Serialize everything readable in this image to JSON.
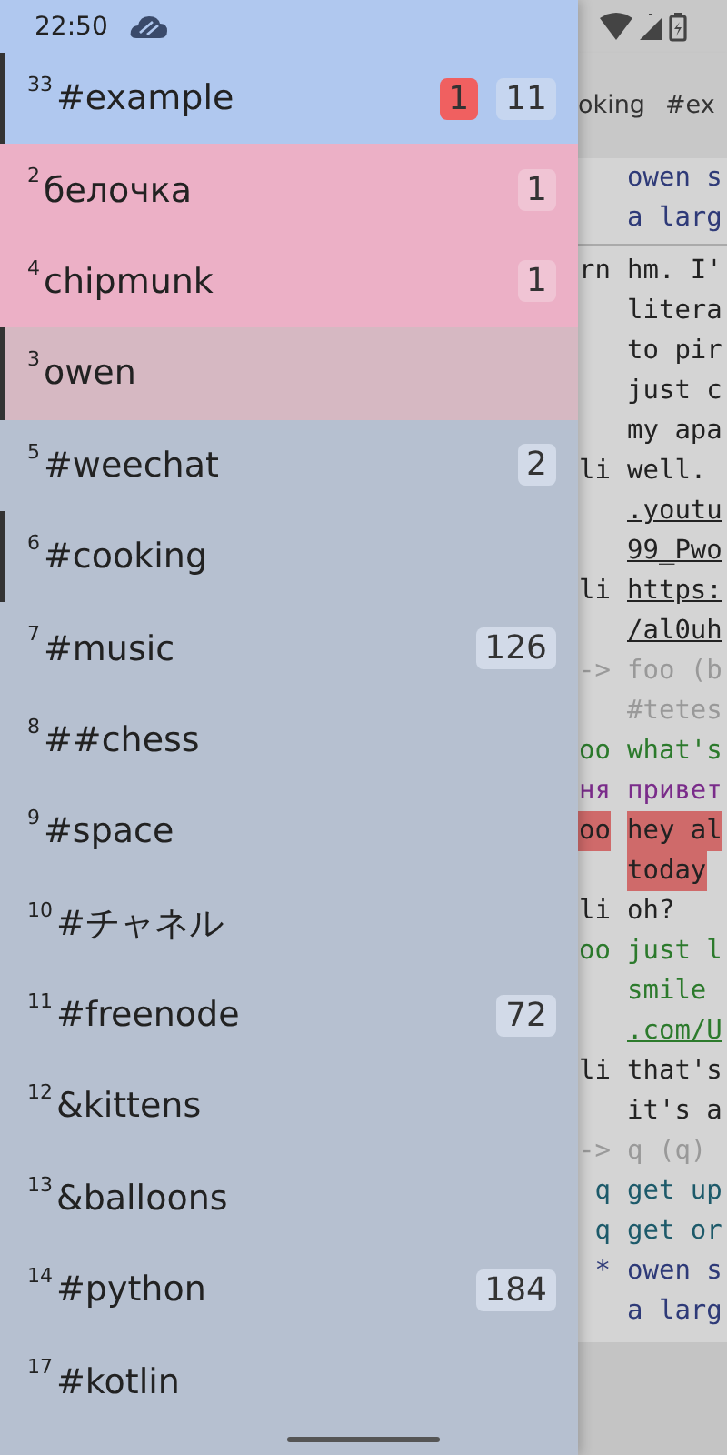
{
  "status_bar": {
    "time": "22:50"
  },
  "chat": {
    "tabs": [
      "oking",
      "#ex"
    ],
    "messages": [
      {
        "kind": "action",
        "lines": [
          {
            "text": "owen s",
            "link": false
          },
          {
            "text": "a larg",
            "link": false
          }
        ],
        "highlight": false
      },
      {
        "prefix": "rn",
        "kind": "normal",
        "lines": [
          {
            "text": "hm. I'",
            "link": false
          },
          {
            "text": "litera",
            "link": false
          },
          {
            "text": "to pir",
            "link": false
          },
          {
            "text": "just c",
            "link": false
          },
          {
            "text": "my apa",
            "link": false
          }
        ],
        "highlight": false
      },
      {
        "prefix": "li",
        "kind": "normal",
        "lines": [
          {
            "text": "well.",
            "link": false
          },
          {
            "text": ".youtu",
            "link": true
          },
          {
            "text": "99_Pwo",
            "link": true
          }
        ],
        "highlight": false
      },
      {
        "prefix": "li",
        "kind": "normal",
        "lines": [
          {
            "text": "https:",
            "link": true
          },
          {
            "text": "/al0uh",
            "link": true
          }
        ],
        "highlight": false
      },
      {
        "prefix": "->",
        "kind": "join",
        "lines": [
          {
            "text": "foo (b",
            "link": false
          },
          {
            "text": "#tetes",
            "link": false
          }
        ],
        "highlight": false
      },
      {
        "prefix": "oo",
        "kind": "green",
        "lines": [
          {
            "text": "what's",
            "link": false
          }
        ],
        "highlight": false
      },
      {
        "prefix": "ня",
        "kind": "purple",
        "lines": [
          {
            "text": "привет",
            "link": false
          }
        ],
        "highlight": false
      },
      {
        "prefix": "oo",
        "kind": "normal",
        "lines": [
          {
            "text": "hey al",
            "link": false
          },
          {
            "text": "today",
            "link": false
          }
        ],
        "highlight": true
      },
      {
        "prefix": "li",
        "kind": "normal",
        "lines": [
          {
            "text": "oh?",
            "link": false
          }
        ],
        "highlight": false
      },
      {
        "prefix": "oo",
        "kind": "green",
        "lines": [
          {
            "text": "just l",
            "link": false
          },
          {
            "text": "smile",
            "link": false
          },
          {
            "text": ".com/U",
            "link": true
          }
        ],
        "highlight": false
      },
      {
        "prefix": "li",
        "kind": "normal",
        "lines": [
          {
            "text": "that's",
            "link": false
          },
          {
            "text": "it's a",
            "link": false
          }
        ],
        "highlight": false
      },
      {
        "prefix": "->",
        "kind": "join",
        "lines": [
          {
            "text": "q (q)",
            "link": false
          }
        ],
        "highlight": false
      },
      {
        "prefix": "q",
        "kind": "teal",
        "lines": [
          {
            "text": "get up",
            "link": false
          }
        ],
        "highlight": false
      },
      {
        "prefix": "q",
        "kind": "teal",
        "lines": [
          {
            "text": "get or",
            "link": false
          }
        ],
        "highlight": false
      },
      {
        "prefix": "*",
        "kind": "action",
        "lines": [
          {
            "text": "owen s",
            "link": false
          },
          {
            "text": "a larg",
            "link": false
          }
        ],
        "highlight": false
      }
    ]
  },
  "buffers": [
    {
      "number": "33",
      "name": "#example",
      "hot": "1",
      "unread": "11",
      "selected": true,
      "highlighted": false,
      "private": false,
      "open": true
    },
    {
      "number": "2",
      "name": "белочка",
      "unread": "1",
      "selected": false,
      "highlighted": true,
      "private": false,
      "open": false
    },
    {
      "number": "4",
      "name": "chipmunk",
      "unread": "1",
      "selected": false,
      "highlighted": true,
      "private": false,
      "open": false
    },
    {
      "number": "3",
      "name": "owen",
      "selected": false,
      "highlighted": false,
      "private": true,
      "open": true
    },
    {
      "number": "5",
      "name": "#weechat",
      "unread": "2",
      "selected": false,
      "highlighted": false,
      "private": false,
      "open": false
    },
    {
      "number": "6",
      "name": "#cooking",
      "selected": false,
      "highlighted": false,
      "private": false,
      "open": true
    },
    {
      "number": "7",
      "name": "#music",
      "unread": "126",
      "selected": false,
      "highlighted": false,
      "private": false,
      "open": false
    },
    {
      "number": "8",
      "name": "##chess",
      "selected": false,
      "highlighted": false,
      "private": false,
      "open": false
    },
    {
      "number": "9",
      "name": "#space",
      "selected": false,
      "highlighted": false,
      "private": false,
      "open": false
    },
    {
      "number": "10",
      "name": "#チャネル",
      "selected": false,
      "highlighted": false,
      "private": false,
      "open": false
    },
    {
      "number": "11",
      "name": "#freenode",
      "unread": "72",
      "selected": false,
      "highlighted": false,
      "private": false,
      "open": false
    },
    {
      "number": "12",
      "name": "&kittens",
      "selected": false,
      "highlighted": false,
      "private": false,
      "open": false
    },
    {
      "number": "13",
      "name": "&balloons",
      "selected": false,
      "highlighted": false,
      "private": false,
      "open": false
    },
    {
      "number": "14",
      "name": "#python",
      "unread": "184",
      "selected": false,
      "highlighted": false,
      "private": false,
      "open": false
    },
    {
      "number": "17",
      "name": "#kotlin",
      "selected": false,
      "highlighted": false,
      "private": false,
      "open": false
    }
  ]
}
